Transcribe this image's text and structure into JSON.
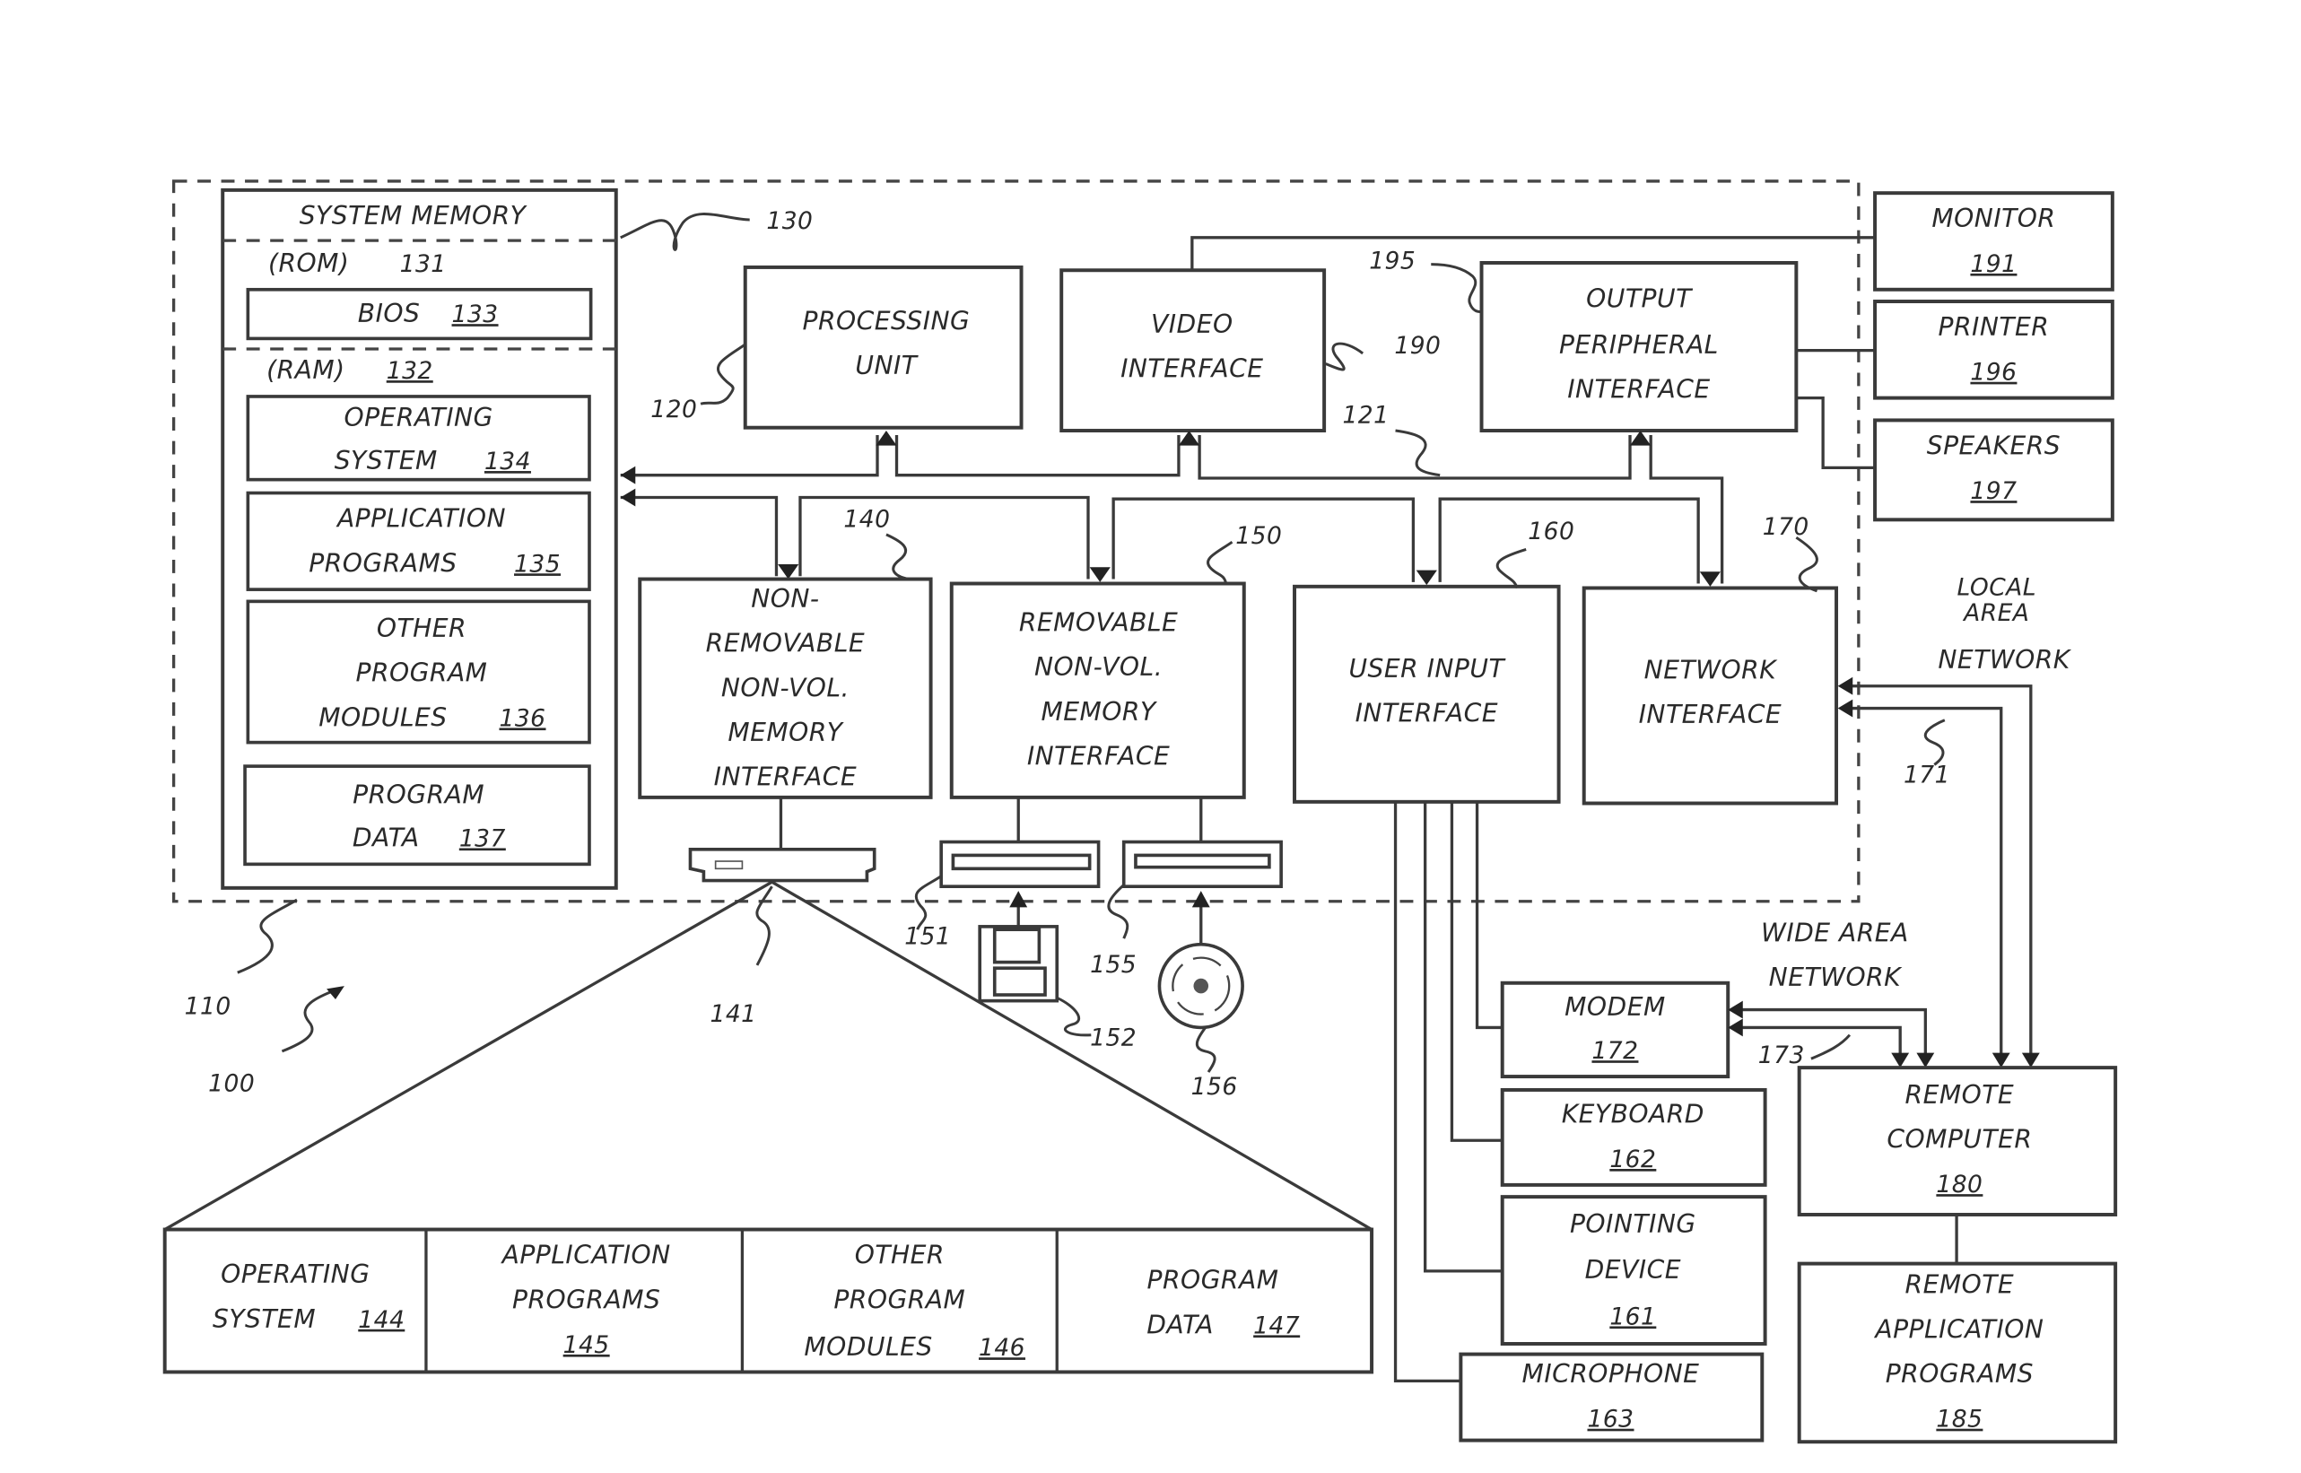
{
  "figure": {
    "figure_ref": "100",
    "computer_ref": "110",
    "system_bus_ref": "121"
  },
  "system_memory": {
    "title": "SYSTEM MEMORY",
    "ref": "130",
    "rom": {
      "label": "(ROM)",
      "ref": "131"
    },
    "bios": {
      "label": "BIOS",
      "ref": "133"
    },
    "ram": {
      "label": "(RAM)",
      "ref": "132"
    },
    "items": [
      {
        "lines": [
          "OPERATING",
          "SYSTEM"
        ],
        "ref": "134"
      },
      {
        "lines": [
          "APPLICATION",
          "PROGRAMS"
        ],
        "ref": "135"
      },
      {
        "lines": [
          "OTHER",
          "PROGRAM",
          "MODULES"
        ],
        "ref": "136"
      },
      {
        "lines": [
          "PROGRAM",
          "DATA"
        ],
        "ref": "137"
      }
    ]
  },
  "processing_unit": {
    "lines": [
      "PROCESSING",
      "UNIT"
    ],
    "ref": "120"
  },
  "video_interface": {
    "lines": [
      "VIDEO",
      "INTERFACE"
    ],
    "ref": "190"
  },
  "output_peripheral_interface": {
    "lines": [
      "OUTPUT",
      "PERIPHERAL",
      "INTERFACE"
    ],
    "ref": "195"
  },
  "non_removable_interface": {
    "lines": [
      "NON-",
      "REMOVABLE",
      "NON-VOL.",
      "MEMORY",
      "INTERFACE"
    ],
    "ref": "140"
  },
  "removable_interface": {
    "lines": [
      "REMOVABLE",
      "NON-VOL.",
      "MEMORY",
      "INTERFACE"
    ],
    "ref": "150"
  },
  "user_input_interface": {
    "lines": [
      "USER INPUT",
      "INTERFACE"
    ],
    "ref": "160"
  },
  "network_interface": {
    "lines": [
      "NETWORK",
      "INTERFACE"
    ],
    "ref": "170"
  },
  "peripherals": {
    "monitor": {
      "label": "MONITOR",
      "ref": "191"
    },
    "printer": {
      "label": "PRINTER",
      "ref": "196"
    },
    "speakers": {
      "label": "SPEAKERS",
      "ref": "197"
    }
  },
  "drives": {
    "hard_disk_ref": "141",
    "magnetic_disk_drive_ref": "151",
    "floppy_disk_ref": "152",
    "optical_drive_ref": "155",
    "optical_disk_ref": "156"
  },
  "stored_programs": [
    {
      "lines": [
        "OPERATING",
        "SYSTEM"
      ],
      "ref": "144"
    },
    {
      "lines": [
        "APPLICATION",
        "PROGRAMS"
      ],
      "ref": "145"
    },
    {
      "lines": [
        "OTHER",
        "PROGRAM",
        "MODULES"
      ],
      "ref": "146"
    },
    {
      "lines": [
        "PROGRAM",
        "DATA"
      ],
      "ref": "147"
    }
  ],
  "input_devices": {
    "modem": {
      "label": "MODEM",
      "ref": "172"
    },
    "keyboard": {
      "label": "KEYBOARD",
      "ref": "162"
    },
    "pointing_device": {
      "lines": [
        "POINTING",
        "DEVICE"
      ],
      "ref": "161"
    },
    "microphone": {
      "label": "MICROPHONE",
      "ref": "163"
    }
  },
  "networks": {
    "lan": {
      "lines": [
        "LOCAL",
        "AREA",
        "NETWORK"
      ],
      "ref": "171"
    },
    "wan": {
      "lines": [
        "WIDE AREA",
        "NETWORK"
      ],
      "ref": "173"
    }
  },
  "remote_computer": {
    "lines": [
      "REMOTE",
      "COMPUTER"
    ],
    "ref": "180"
  },
  "remote_application_programs": {
    "lines": [
      "REMOTE",
      "APPLICATION",
      "PROGRAMS"
    ],
    "ref": "185"
  }
}
